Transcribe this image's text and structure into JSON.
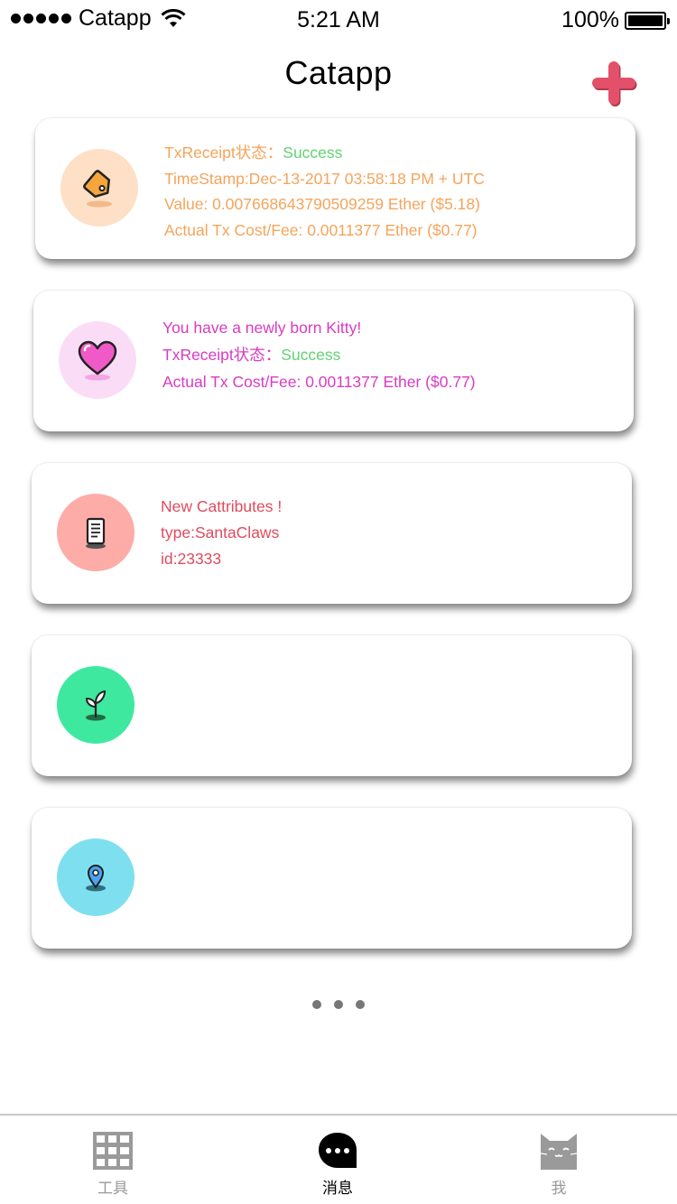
{
  "status_bar": {
    "carrier": "Catapp",
    "time": "5:21 AM",
    "battery": "100%",
    "icons": [
      "signal-dots-icon",
      "wifi-icon",
      "battery-icon"
    ]
  },
  "nav": {
    "title": "Catapp",
    "add_icon": "plus-icon",
    "accent_color": "#e2506a"
  },
  "cards": [
    {
      "icon": "price-tag-icon",
      "icon_bg": "#fde0c6",
      "text_color": "#f5a45b",
      "lines": [
        {
          "label": "TxReceipt状态：",
          "value": "Success"
        },
        {
          "text": "TimeStamp:Dec-13-2017 03:58:18 PM + UTC"
        },
        {
          "text": "Value: 0.007668643790509259 Ether ($5.18)"
        },
        {
          "text": "Actual Tx Cost/Fee: 0.0011377 Ether ($0.77)"
        }
      ]
    },
    {
      "icon": "heart-icon",
      "icon_bg": "#fbdcf6",
      "text_color": "#d93bc2",
      "lines": [
        {
          "text": "You have a newly born Kitty!"
        },
        {
          "label": "TxReceipt状态：",
          "value": "Success"
        },
        {
          "text": "Actual Tx Cost/Fee: 0.0011377 Ether ($0.77)"
        }
      ]
    },
    {
      "icon": "document-icon",
      "icon_bg": "#fdaca7",
      "text_color": "#e04b5e",
      "lines": [
        {
          "text": "New Cattributes !"
        },
        {
          "text": "type:SantaClaws"
        },
        {
          "text": "id:23333"
        }
      ]
    },
    {
      "icon": "sprout-icon",
      "icon_bg": "#3ee99f",
      "lines": []
    },
    {
      "icon": "location-pin-icon",
      "icon_bg": "#7ee0ef",
      "lines": []
    }
  ],
  "success_color": "#62d272",
  "tabs": [
    {
      "label": "工具",
      "icon": "grid-icon",
      "active": false
    },
    {
      "label": "消息",
      "icon": "chat-bubble-icon",
      "active": true
    },
    {
      "label": "我",
      "icon": "cat-face-icon",
      "active": false
    }
  ]
}
